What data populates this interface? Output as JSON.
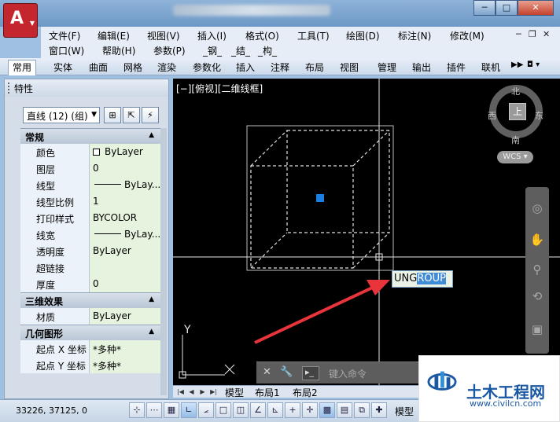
{
  "window": {
    "min": "─",
    "max": "□",
    "close": "✕"
  },
  "menu": {
    "row1": [
      "文件(F)",
      "编辑(E)",
      "视图(V)",
      "插入(I)",
      "格式(O)",
      "工具(T)",
      "绘图(D)",
      "标注(N)",
      "修改(M)"
    ],
    "row2": [
      "窗口(W)",
      "帮助(H)",
      "参数(P)",
      "_钢_",
      "_结_",
      "_构_"
    ]
  },
  "ribbon_tabs": [
    "常用",
    "实体",
    "曲面",
    "网格",
    "渲染",
    "参数化",
    "插入",
    "注释",
    "布局",
    "视图",
    "管理",
    "输出",
    "插件",
    "联机"
  ],
  "properties": {
    "title": "特性",
    "selection": "直线 (12) (组)",
    "sections": [
      {
        "name": "常规",
        "rows": [
          {
            "label": "颜色",
            "value": "ByLayer"
          },
          {
            "label": "图层",
            "value": "0"
          },
          {
            "label": "线型",
            "value": "ByLay..."
          },
          {
            "label": "线型比例",
            "value": "1"
          },
          {
            "label": "打印样式",
            "value": "BYCOLOR"
          },
          {
            "label": "线宽",
            "value": "ByLay..."
          },
          {
            "label": "透明度",
            "value": "ByLayer"
          },
          {
            "label": "超链接",
            "value": ""
          },
          {
            "label": "厚度",
            "value": "0"
          }
        ]
      },
      {
        "name": "三维效果",
        "rows": [
          {
            "label": "材质",
            "value": "ByLayer"
          }
        ]
      },
      {
        "name": "几何图形",
        "rows": [
          {
            "label": "起点 X 坐标",
            "value": "*多种*"
          },
          {
            "label": "起点 Y 坐标",
            "value": "*多种*"
          }
        ]
      }
    ]
  },
  "viewport": {
    "label": "[−][俯视][二维线框]",
    "compass": {
      "n": "北",
      "s": "南",
      "e": "东",
      "w": "西",
      "top": "上"
    },
    "wcs": "WCS",
    "ucs_y": "Y",
    "command_placeholder": "键入命令",
    "dynamic_input_typed": "UNG",
    "dynamic_input_suggest": "ROUP"
  },
  "layout_tabs": [
    "模型",
    "布局1",
    "布局2"
  ],
  "status": {
    "coords": "33226, 37125, 0",
    "model": "模型"
  },
  "watermark": {
    "name": "土木工程网",
    "url": "www.civilcn.com"
  },
  "colors": {
    "arrow": "#e8343a",
    "grip": "#1a7fe0"
  }
}
